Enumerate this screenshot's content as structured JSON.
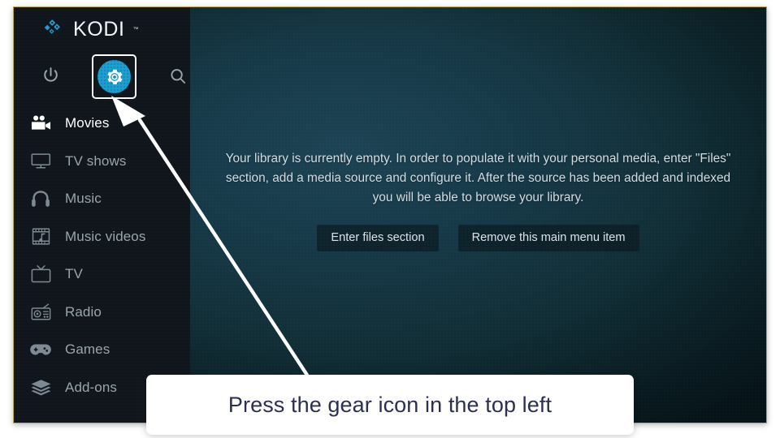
{
  "app": {
    "name": "KODI",
    "trademark": "™",
    "logo_icon": "kodi-logo-icon",
    "accent_color": "#1b9ed0",
    "sidebar_bg": "#10161b",
    "frame_border_color": "#b9a43c"
  },
  "topbar": {
    "items": [
      {
        "name": "power-icon",
        "label": "Power",
        "selected": false
      },
      {
        "name": "gear-icon",
        "label": "Settings",
        "selected": true
      },
      {
        "name": "search-icon",
        "label": "Search",
        "selected": false
      }
    ]
  },
  "sidebar": {
    "items": [
      {
        "label": "Movies",
        "icon": "movie-camera-icon",
        "active": true
      },
      {
        "label": "TV shows",
        "icon": "television-icon",
        "active": false
      },
      {
        "label": "Music",
        "icon": "headphones-icon",
        "active": false
      },
      {
        "label": "Music videos",
        "icon": "film-note-icon",
        "active": false
      },
      {
        "label": "TV",
        "icon": "tv-antenna-icon",
        "active": false
      },
      {
        "label": "Radio",
        "icon": "radio-icon",
        "active": false
      },
      {
        "label": "Games",
        "icon": "gamepad-icon",
        "active": false
      },
      {
        "label": "Add-ons",
        "icon": "addons-box-icon",
        "active": false
      }
    ]
  },
  "main": {
    "empty_message": "Your library is currently empty. In order to populate it with your personal media, enter \"Files\" section, add a media source and configure it. After the source has been added and indexed you will be able to browse your library.",
    "buttons": [
      {
        "label": "Enter files section"
      },
      {
        "label": "Remove this main menu item"
      }
    ]
  },
  "annotation": {
    "callout_text": "Press the gear icon in the top left",
    "arrow_icon": "arrow-pointer-icon",
    "arrow_color": "#ffffff",
    "callout_bg": "#ffffff",
    "callout_text_color": "#2b3050"
  }
}
